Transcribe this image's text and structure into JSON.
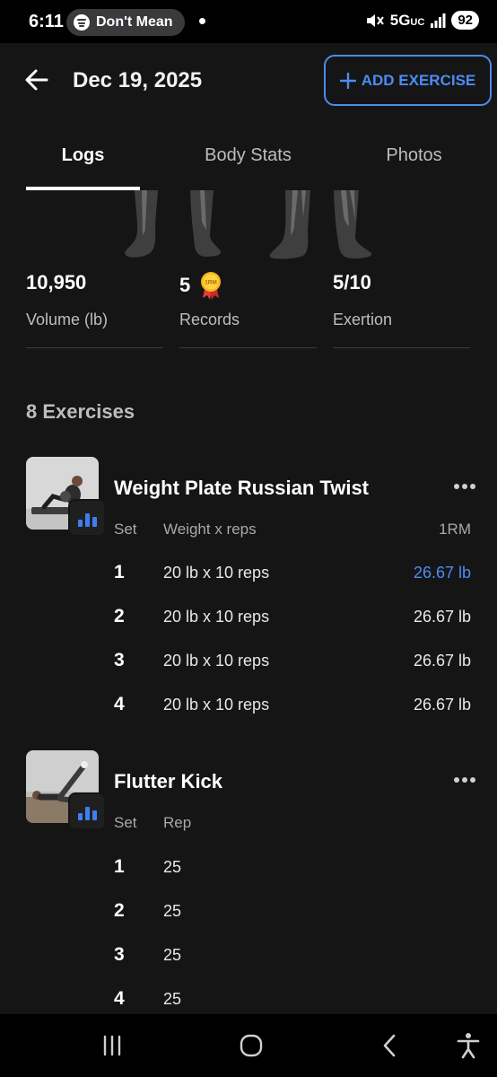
{
  "status_bar": {
    "time": "6:11",
    "media_text": "Don't Mean",
    "network": "5G",
    "network_sub": "UC",
    "battery": "92"
  },
  "header": {
    "title": "Dec 19, 2025",
    "add_label": "ADD EXERCISE"
  },
  "tabs": [
    "Logs",
    "Body Stats",
    "Photos"
  ],
  "stats": [
    {
      "value": "10,950",
      "label": "Volume (lb)"
    },
    {
      "value": "5",
      "label": "Records",
      "badge": "1RM"
    },
    {
      "value": "5/10",
      "label": "Exertion"
    }
  ],
  "exercise_count": "8 Exercises",
  "exercises": [
    {
      "name": "Weight Plate Russian Twist",
      "col_set": "Set",
      "col_main": "Weight x reps",
      "col_1rm": "1RM",
      "rows": [
        {
          "set": "1",
          "value": "20 lb x 10 reps",
          "one_rm": "26.67 lb"
        },
        {
          "set": "2",
          "value": "20 lb x 10 reps",
          "one_rm": "26.67 lb"
        },
        {
          "set": "3",
          "value": "20 lb x 10 reps",
          "one_rm": "26.67 lb"
        },
        {
          "set": "4",
          "value": "20 lb x 10 reps",
          "one_rm": "26.67 lb"
        }
      ]
    },
    {
      "name": "Flutter Kick",
      "col_set": "Set",
      "col_main": "Rep",
      "rows": [
        {
          "set": "1",
          "value": "25"
        },
        {
          "set": "2",
          "value": "25"
        },
        {
          "set": "3",
          "value": "25"
        },
        {
          "set": "4",
          "value": "25"
        }
      ]
    }
  ],
  "colors": {
    "background": "#151515",
    "accent": "#4b8cf3",
    "muted_text": "#bdbdbd"
  }
}
